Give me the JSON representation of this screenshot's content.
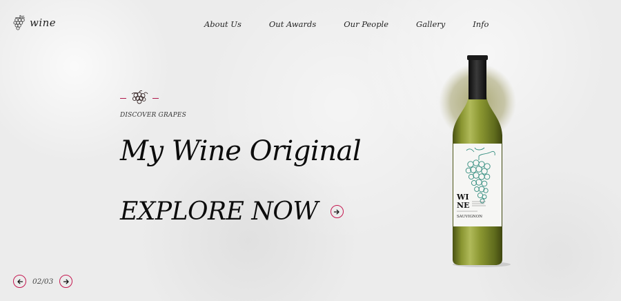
{
  "brand": {
    "name": "wine"
  },
  "nav": {
    "items": [
      {
        "label": "About Us"
      },
      {
        "label": "Out Awards"
      },
      {
        "label": "Our People"
      },
      {
        "label": "Gallery"
      },
      {
        "label": "Info"
      }
    ]
  },
  "hero": {
    "eyebrow": "DISCOVER GRAPES",
    "title": "My Wine Original",
    "cta_label": "EXPLORE NOW"
  },
  "pager": {
    "current": "02/03"
  },
  "bottle_label": {
    "word_line1": "WI",
    "word_line2": "NE",
    "variety": "SAUVIGNON"
  },
  "colors": {
    "accent": "#c4164f",
    "background": "#ececec",
    "text": "#0c0c0c",
    "grape_print": "#2f8b7c",
    "bottle_glass": "#7e8a2a"
  },
  "icons": {
    "logo": "grape-cluster-icon",
    "ornament": "grape-ornament-icon",
    "cta": "arrow-right-icon",
    "prev": "arrow-left-icon",
    "next": "arrow-right-icon"
  }
}
